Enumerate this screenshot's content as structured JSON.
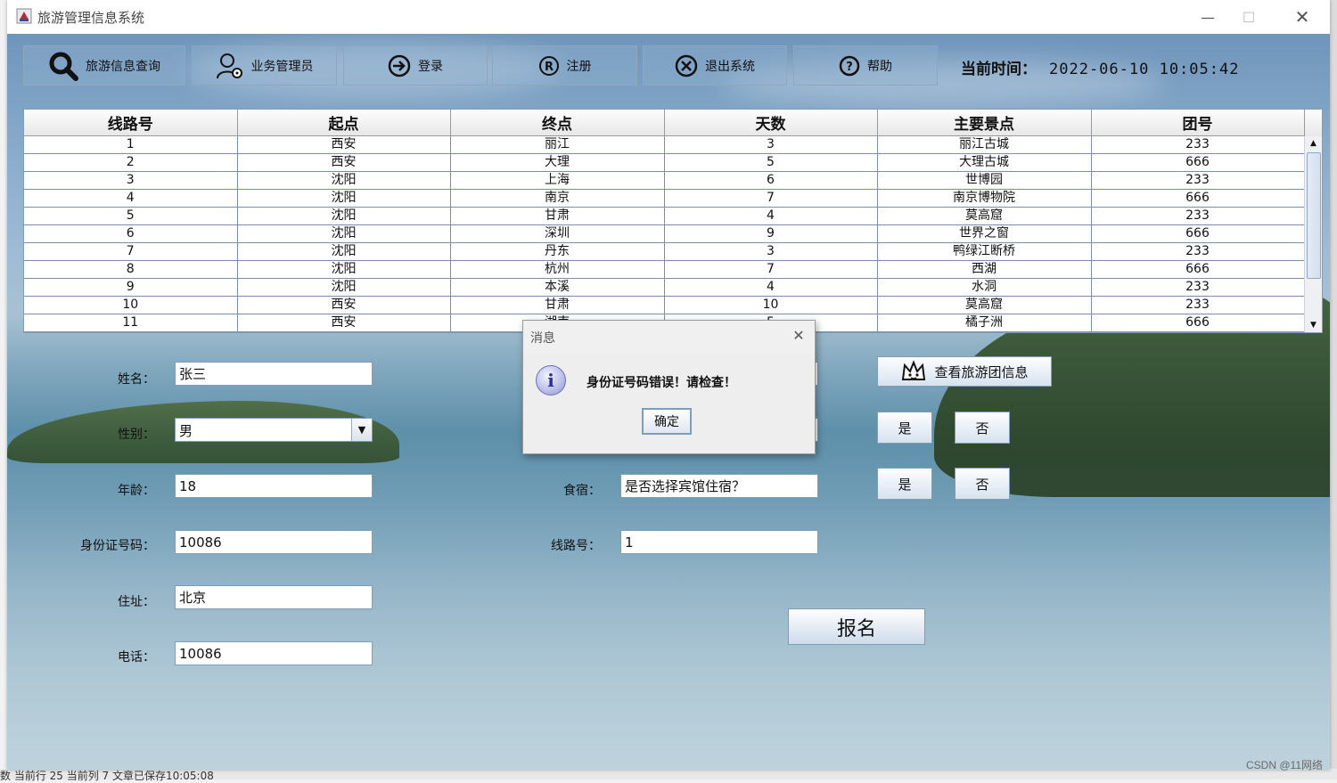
{
  "window": {
    "title": "旅游管理信息系统"
  },
  "toolbar": {
    "query": "旅游信息查询",
    "admin": "业务管理员",
    "login": "登录",
    "register": "注册",
    "exit": "退出系统",
    "help": "帮助"
  },
  "clock": {
    "label": "当前时间：",
    "value": "2022-06-10 10:05:42"
  },
  "table": {
    "columns": [
      "线路号",
      "起点",
      "终点",
      "天数",
      "主要景点",
      "团号"
    ],
    "rows": [
      [
        "1",
        "西安",
        "丽江",
        "3",
        "丽江古城",
        "233"
      ],
      [
        "2",
        "西安",
        "大理",
        "5",
        "大理古城",
        "666"
      ],
      [
        "3",
        "沈阳",
        "上海",
        "6",
        "世博园",
        "233"
      ],
      [
        "4",
        "沈阳",
        "南京",
        "7",
        "南京博物院",
        "666"
      ],
      [
        "5",
        "沈阳",
        "甘肃",
        "4",
        "莫高窟",
        "233"
      ],
      [
        "6",
        "沈阳",
        "深圳",
        "9",
        "世界之窗",
        "666"
      ],
      [
        "7",
        "沈阳",
        "丹东",
        "3",
        "鸭绿江断桥",
        "233"
      ],
      [
        "8",
        "沈阳",
        "杭州",
        "7",
        "西湖",
        "666"
      ],
      [
        "9",
        "沈阳",
        "本溪",
        "4",
        "水洞",
        "233"
      ],
      [
        "10",
        "西安",
        "甘肃",
        "10",
        "莫高窟",
        "233"
      ],
      [
        "11",
        "西安",
        "湖南",
        "5",
        "橘子洲",
        "666"
      ]
    ]
  },
  "form": {
    "name_label": "姓名：",
    "name_value": "张三",
    "gender_label": "性别：",
    "gender_value": "男",
    "age_label": "年龄：",
    "age_value": "18",
    "id_label": "身份证号码：",
    "id_value": "10086",
    "address_label": "住址：",
    "address_value": "北京",
    "phone_label": "电话：",
    "phone_value": "10086",
    "lodging_label": "食宿：",
    "lodging_value": "是否选择宾馆住宿？",
    "route_label": "线路号：",
    "route_value": "1"
  },
  "actions": {
    "view_group": "查看旅游团信息",
    "yes1": "是",
    "no1": "否",
    "yes2": "是",
    "no2": "否",
    "signup": "报名"
  },
  "dialog": {
    "title": "消息",
    "message": "身份证号码错误！请检查！",
    "ok": "确定",
    "icon": "info-icon"
  },
  "background_status": "数  当前行 25  当前列 7  文章已保存10:05:08",
  "watermark": "CSDN @11网络"
}
